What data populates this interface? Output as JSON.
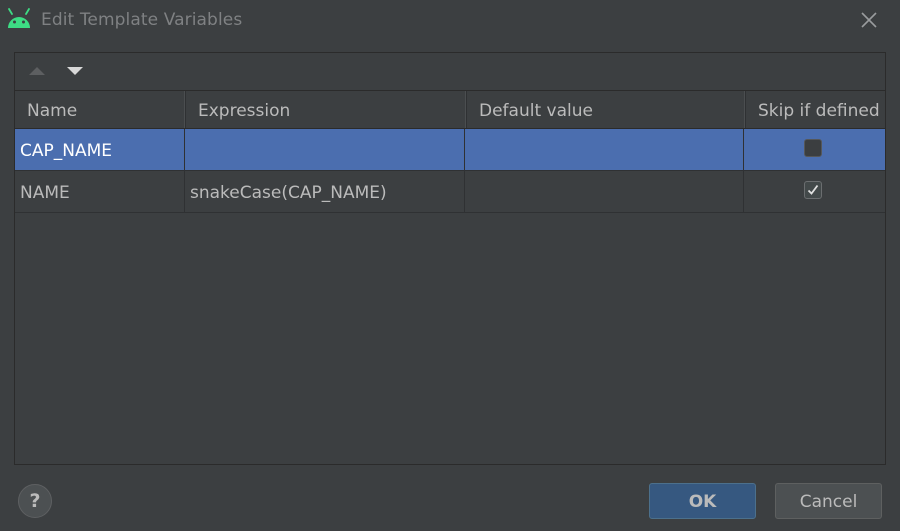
{
  "window": {
    "title": "Edit Template Variables",
    "app_icon": "android-icon",
    "close_icon": "close-icon"
  },
  "toolbar": {
    "move_up_icon": "arrow-up-icon",
    "move_down_icon": "arrow-down-icon"
  },
  "table": {
    "columns": [
      "Name",
      "Expression",
      "Default value",
      "Skip if defined"
    ],
    "rows": [
      {
        "name": "CAP_NAME",
        "expression": "",
        "default_value": "",
        "skip_if_defined": false,
        "selected": true
      },
      {
        "name": "NAME",
        "expression": "snakeCase(CAP_NAME)",
        "default_value": "",
        "skip_if_defined": true,
        "selected": false
      }
    ]
  },
  "footer": {
    "help_label": "?",
    "ok_label": "OK",
    "cancel_label": "Cancel"
  },
  "colors": {
    "background": "#3c3f41",
    "selection": "#4b6eaf",
    "accent_button": "#365880",
    "android_green": "#3ddc84"
  }
}
